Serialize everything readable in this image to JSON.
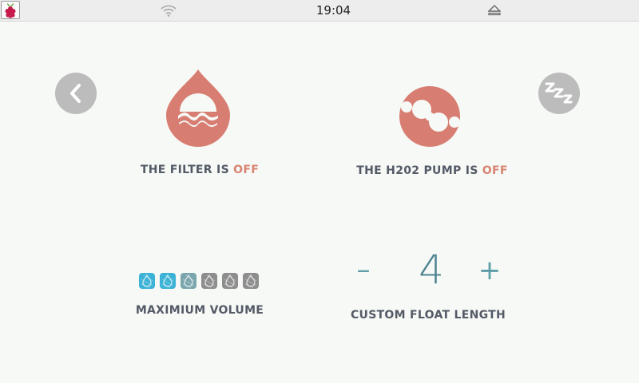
{
  "taskbar": {
    "time": "19:04",
    "menu_icon": "raspberry-pi-logo",
    "wifi_icon": "wifi-icon",
    "eject_icon": "eject-icon"
  },
  "controls": {
    "back_icon": "chevron-left-icon",
    "sleep_icon": "sleep-zzz-icon"
  },
  "filter": {
    "icon": "water-drop-icon",
    "label": "THE FILTER IS",
    "state": "OFF"
  },
  "pump": {
    "icon": "bubbles-icon",
    "label": "THE H202 PUMP IS",
    "state": "OFF"
  },
  "volume": {
    "label": "MAXIMIUM VOLUME",
    "levels_total": 6,
    "level": 2
  },
  "float_length": {
    "label": "CUSTOM FLOAT LENGTH",
    "decrement_label": "–",
    "value": "4",
    "increment_label": "+"
  },
  "colors": {
    "background": "#f6f9f6",
    "accent_off": "#d98473",
    "icon_red": "#d87d71",
    "text": "#545a66",
    "teal": "#5e9ea8",
    "volume_active": "#3cb3d6",
    "volume_partial": "#7ba6ad",
    "volume_inactive": "#8d8d8d",
    "button_gray": "#bcbcbc"
  }
}
